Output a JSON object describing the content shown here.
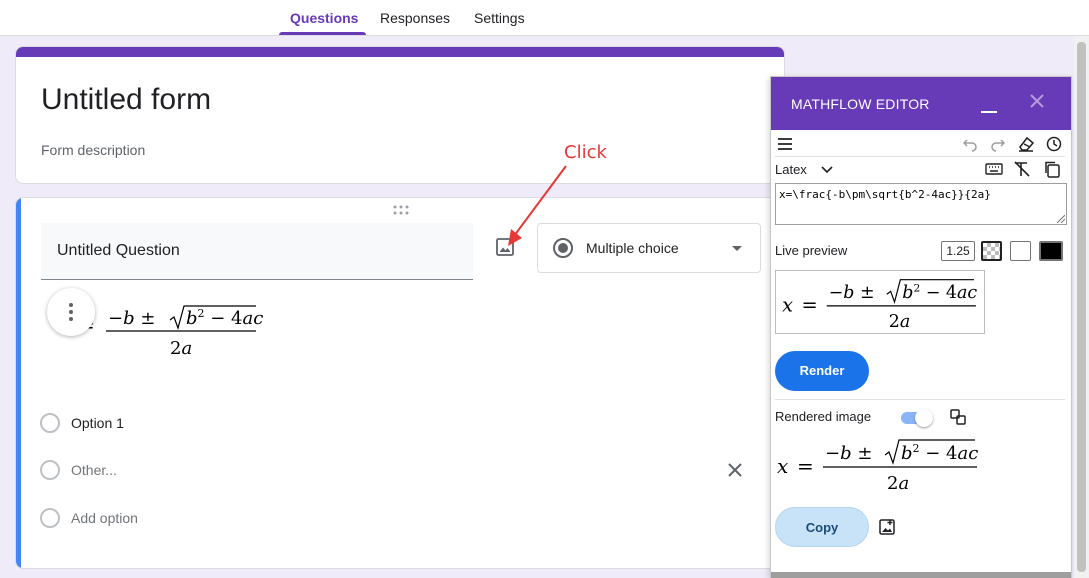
{
  "tabs": [
    "Questions",
    "Responses",
    "Settings"
  ],
  "form": {
    "title": "Untitled form",
    "description": "Form description"
  },
  "question": {
    "title": "Untitled Question",
    "type": "Multiple choice",
    "options": [
      "Option 1"
    ],
    "other_label": "Other...",
    "add_option": "Add option"
  },
  "annotation": {
    "text": "Click",
    "color": "#e53935"
  },
  "mathflow": {
    "title": "MATHFLOW EDITOR",
    "language": "Latex",
    "latex": "x=\\frac{-b\\pm\\sqrt{b^2-4ac}}{2a}",
    "live_preview_label": "Live preview",
    "scale": "1.25",
    "render_label": "Render",
    "rendered_label": "Rendered image",
    "rendered_toggle_on": true,
    "copy_label": "Copy"
  },
  "colors": {
    "accent": "#673ab7",
    "question_bar": "#4285f4",
    "render_button": "#1a73e8",
    "copy_button": "#c8e3f7"
  },
  "icons": [
    "image-icon",
    "close-icon",
    "menu-icon",
    "undo-icon",
    "redo-icon",
    "eraser-icon",
    "history-icon",
    "keyboard-icon",
    "clear-format-icon",
    "copy-icon",
    "swap-icon",
    "insert-image-icon",
    "more-vert-icon",
    "drag-handle-icon"
  ]
}
